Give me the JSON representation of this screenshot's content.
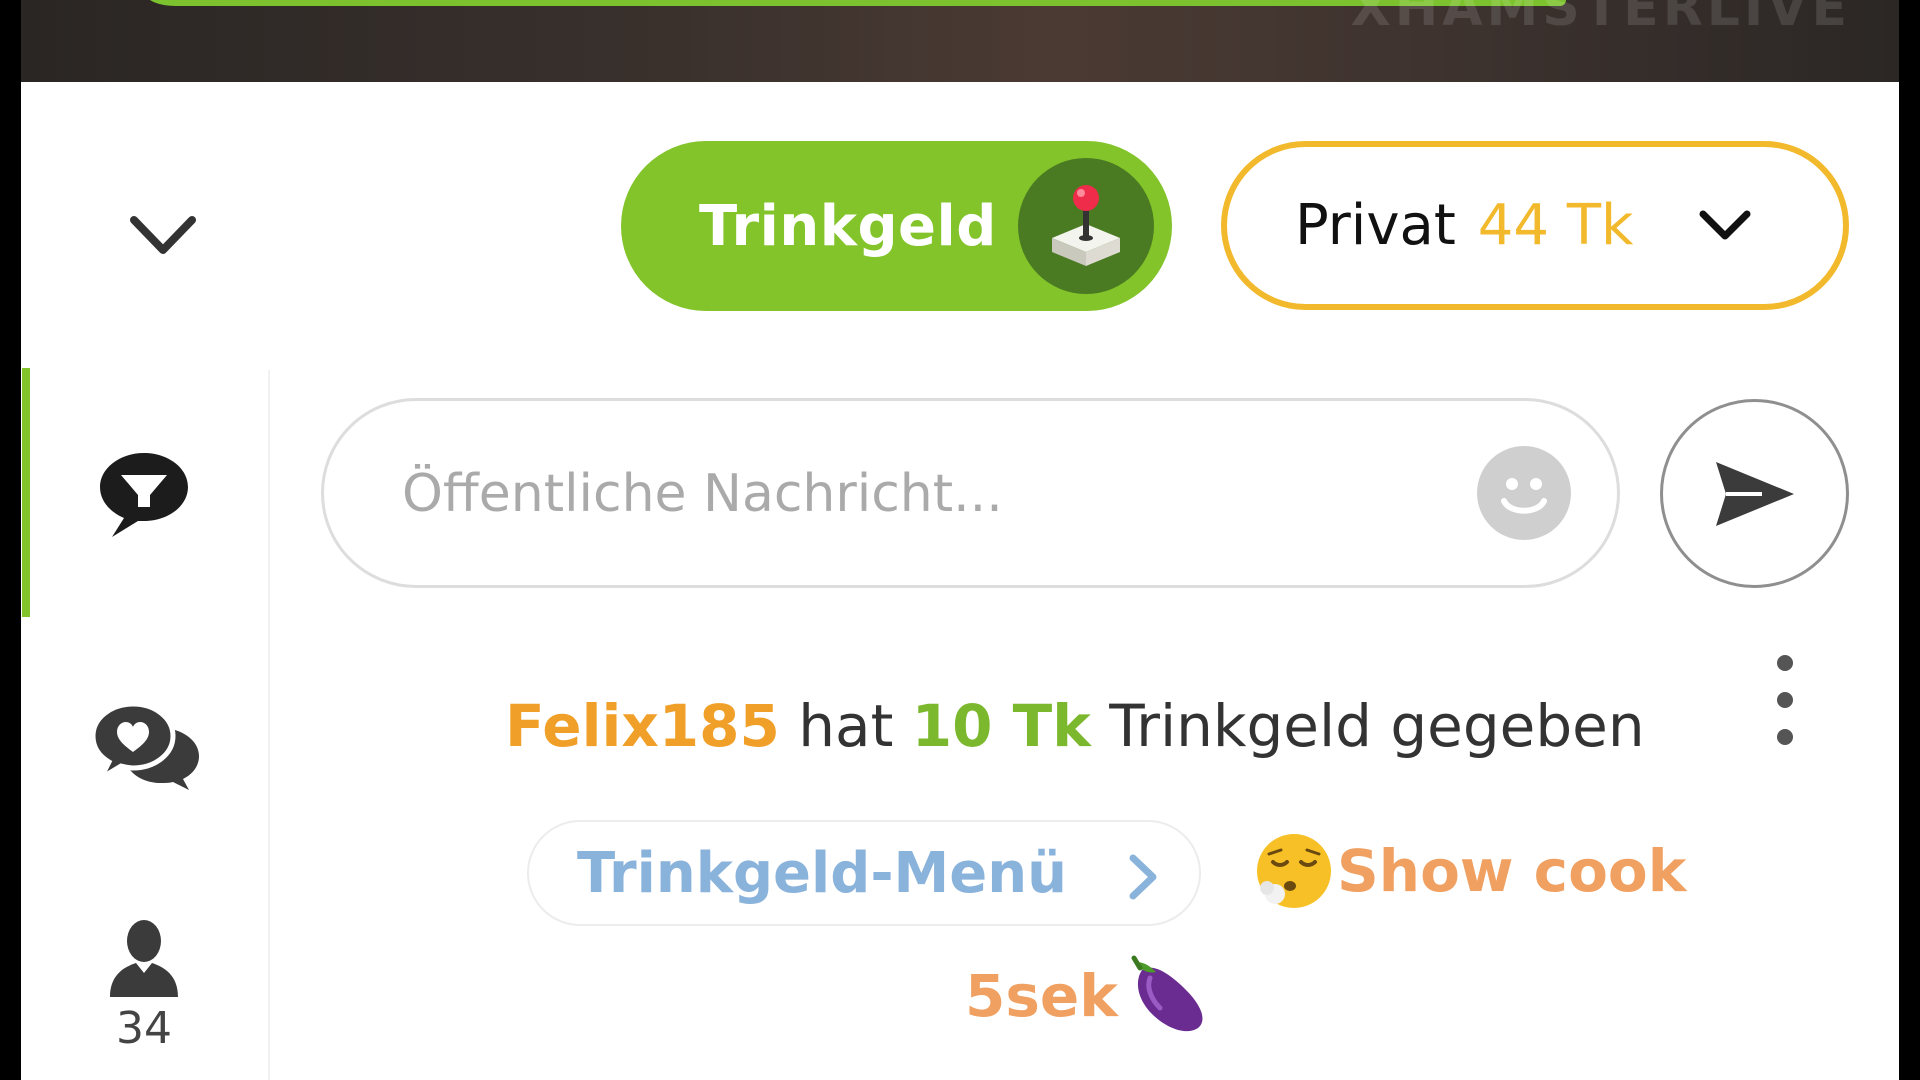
{
  "video": {
    "watermark": "XHAMSTERLIVE",
    "progress": 1.0
  },
  "header": {
    "tip_button_label": "Trinkgeld",
    "private_button": {
      "label": "Privat",
      "price": "44 Tk"
    }
  },
  "sidebar": {
    "viewer_count": "34"
  },
  "composer": {
    "placeholder": "Öffentliche Nachricht..."
  },
  "chat": {
    "tip_event": {
      "user": "Felix185",
      "verb": "hat",
      "amount": "10 Tk",
      "rest": "Trinkgeld gegeben"
    },
    "tip_menu_label": "Trinkgeld-Menü",
    "menu_item": {
      "line1": "Show cook",
      "line2": "5sek"
    }
  },
  "colors": {
    "accent_green": "#82c42a",
    "accent_gold": "#f2b92c",
    "username_orange": "#f0a028",
    "menu_blue": "#8ab3db"
  }
}
